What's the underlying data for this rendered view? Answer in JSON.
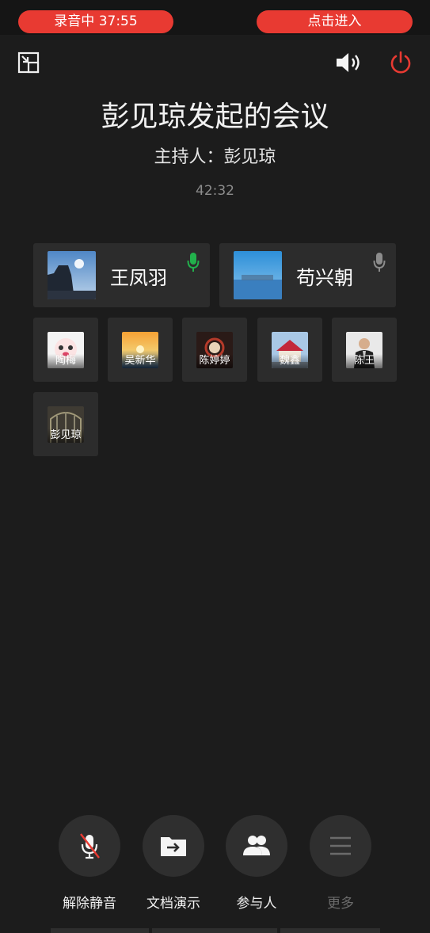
{
  "status_bar": {
    "recording": "录音中   37:55",
    "enter": "点击进入"
  },
  "meeting": {
    "title": "彭见琼发起的会议",
    "host": "主持人：彭见琼",
    "elapsed": "42:32"
  },
  "speakers": [
    {
      "name": "王凤羽",
      "mic_active": true
    },
    {
      "name": "苟兴朝",
      "mic_active": false
    }
  ],
  "participants": [
    {
      "name": "陶梅"
    },
    {
      "name": "吴新华"
    },
    {
      "name": "陈婷婷"
    },
    {
      "name": "魏鑫"
    },
    {
      "name": "陈王"
    },
    {
      "name": "彭见琼"
    }
  ],
  "controls": [
    {
      "label": "解除静音",
      "icon": "mic-muted-icon"
    },
    {
      "label": "文档演示",
      "icon": "document-share-icon"
    },
    {
      "label": "参与人",
      "icon": "participants-icon"
    },
    {
      "label": "更多",
      "icon": "menu-icon",
      "disabled": true
    }
  ],
  "colors": {
    "background": "#1c1c1c",
    "accent_red": "#e83a32",
    "mic_active": "#22b14c",
    "card": "#2c2c2c"
  }
}
